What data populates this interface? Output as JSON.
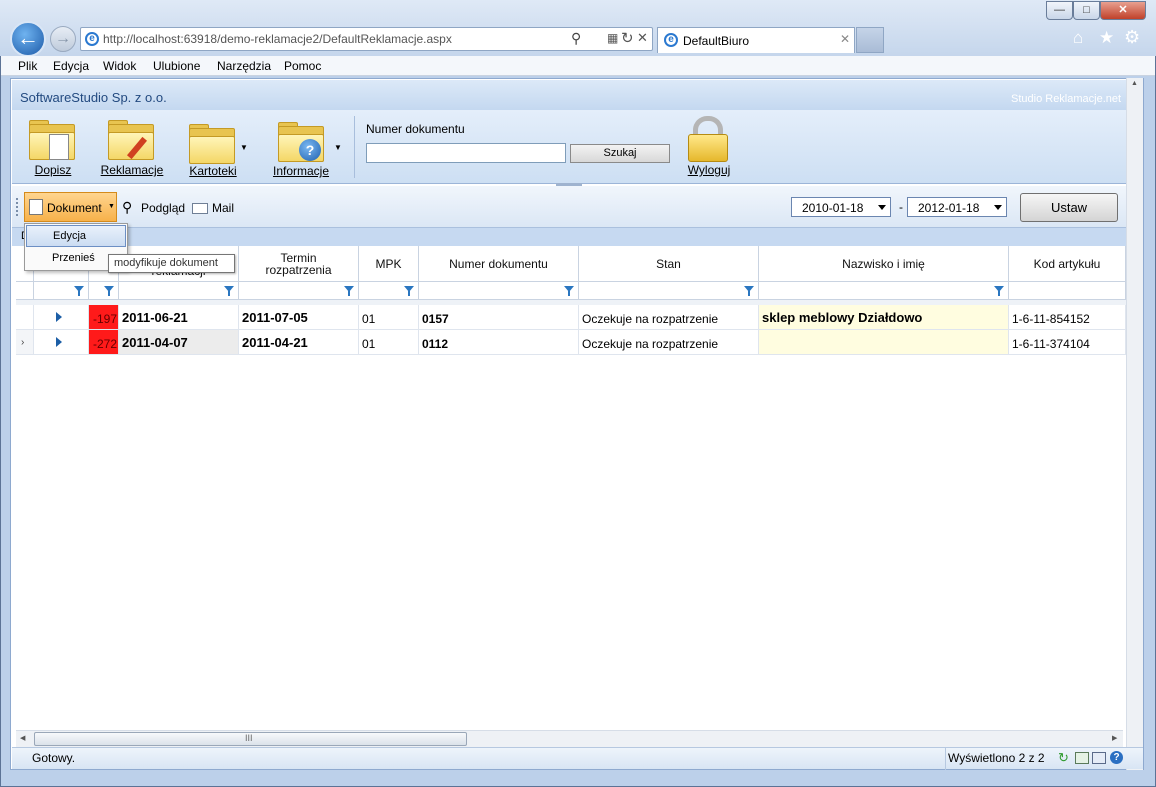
{
  "browser": {
    "url": "http://localhost:63918/demo-reklamacje2/DefaultReklamacje.aspx",
    "tab_title": "DefaultBiuro",
    "caption_buttons": [
      "—",
      "□",
      "✕"
    ]
  },
  "menubar": [
    "Plik",
    "Edycja",
    "Widok",
    "Ulubione",
    "Narzędzia",
    "Pomoc"
  ],
  "app": {
    "company": "SoftwareStudio Sp. z o.o.",
    "brand": "Studio Reklamacje.net"
  },
  "ribbon": {
    "buttons": [
      "Dopisz",
      "Reklamacje",
      "Kartoteki",
      "Informacje"
    ],
    "doc_number_label": "Numer dokumentu",
    "doc_number_value": "",
    "search_label": "Szukaj",
    "logout_label": "Wyloguj"
  },
  "toolbar": {
    "document_label": "Dokument",
    "preview_label": "Podgląd",
    "mail_label": "Mail",
    "date_from": "2010-01-18",
    "date_separator": "-",
    "date_to": "2012-01-18",
    "apply_label": "Ustaw"
  },
  "popup": {
    "items": [
      "Edycja",
      "Przenieś"
    ],
    "tooltip": "modyfikuje dokument",
    "group_hint": "D"
  },
  "grid": {
    "columns": [
      "",
      "",
      "",
      "reklamacji",
      "Termin rozpatrzenia",
      "MPK",
      "Numer dokumentu",
      "Stan",
      "Nazwisko i imię",
      "Kod artykułu"
    ],
    "rows": [
      {
        "days": "-197",
        "date_claim": "2011-06-21",
        "deadline": "2011-07-05",
        "mpk": "01",
        "doc_no": "0157",
        "status": "Oczekuje na rozpatrzenie",
        "name": "sklep meblowy Działdowo",
        "code": "1-6-11-854152"
      },
      {
        "days": "-272",
        "date_claim": "2011-04-07",
        "deadline": "2011-04-21",
        "mpk": "01",
        "doc_no": "0112",
        "status": "Oczekuje na rozpatrzenie",
        "name": "",
        "code": "1-6-11-374104"
      }
    ]
  },
  "statusbar": {
    "left": "Gotowy.",
    "right": "Wyświetlono 2 z 2",
    "scroll_grip": "III"
  },
  "colors": {
    "accent": "#f7b14a",
    "overdue": "#ff1a1a",
    "highlight": "#fffde0",
    "header_blue": "#c4d8f0"
  }
}
